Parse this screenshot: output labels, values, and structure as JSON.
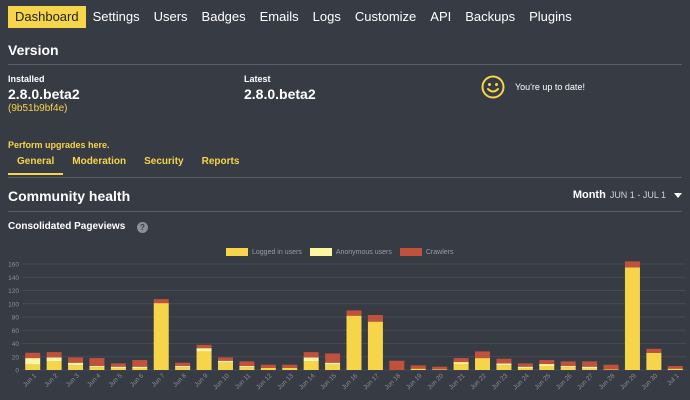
{
  "nav": {
    "items": [
      "Dashboard",
      "Settings",
      "Users",
      "Badges",
      "Emails",
      "Logs",
      "Customize",
      "API",
      "Backups",
      "Plugins"
    ],
    "active": "Dashboard"
  },
  "version": {
    "title": "Version",
    "installed_label": "Installed",
    "installed_value": "2.8.0.beta2",
    "installed_hash": "(9b51b9bf4e)",
    "latest_label": "Latest",
    "latest_value": "2.8.0.beta2",
    "status_text": "You're up to date!",
    "status_icon": "smiley-icon",
    "upgrade_link": "Perform upgrades here."
  },
  "tabs": [
    "General",
    "Moderation",
    "Security",
    "Reports"
  ],
  "active_tab": "General",
  "community": {
    "title": "Community health",
    "period_label": "Month",
    "period_range": "JUN 1 - JUL 1"
  },
  "pageviews": {
    "title": "Consolidated Pageviews",
    "help_icon": "question-icon"
  },
  "colors": {
    "accent": "#f7d54a",
    "background": "#373b44",
    "logged_in": "#f7d54a",
    "anonymous": "#fdf6a0",
    "crawlers": "#c0513c"
  },
  "chart_data": {
    "type": "bar",
    "stacked": true,
    "categories": [
      "Jun 1",
      "Jun 2",
      "Jun 3",
      "Jun 4",
      "Jun 5",
      "Jun 6",
      "Jun 7",
      "Jun 8",
      "Jun 9",
      "Jun 10",
      "Jun 11",
      "Jun 12",
      "Jun 13",
      "Jun 14",
      "Jun 15",
      "Jun 16",
      "Jun 17",
      "Jun 18",
      "Jun 19",
      "Jun 20",
      "Jun 21",
      "Jun 22",
      "Jun 23",
      "Jun 24",
      "Jun 25",
      "Jun 26",
      "Jun 27",
      "Jun 28",
      "Jun 29",
      "Jun 30",
      "Jul 1"
    ],
    "series": [
      {
        "name": "Logged in users",
        "values": [
          8,
          13,
          7,
          4,
          3,
          3,
          101,
          4,
          28,
          11,
          4,
          3,
          3,
          13,
          8,
          82,
          73,
          0,
          2,
          1,
          9,
          18,
          7,
          3,
          6,
          4,
          2,
          1,
          155,
          26,
          2
        ]
      },
      {
        "name": "Anonymous users",
        "values": [
          10,
          6,
          4,
          2,
          2,
          2,
          0,
          2,
          5,
          3,
          2,
          0,
          0,
          6,
          3,
          0,
          0,
          0,
          0,
          0,
          3,
          0,
          3,
          2,
          3,
          2,
          3,
          0,
          0,
          0,
          0
        ]
      },
      {
        "name": "Crawlers",
        "values": [
          8,
          8,
          8,
          12,
          5,
          10,
          6,
          5,
          5,
          5,
          7,
          5,
          5,
          8,
          14,
          8,
          10,
          14,
          5,
          4,
          6,
          10,
          7,
          5,
          6,
          7,
          8,
          7,
          9,
          6,
          4
        ]
      }
    ],
    "yticks": [
      "0",
      "20",
      "40",
      "60",
      "80",
      "100",
      "120",
      "140",
      "160"
    ],
    "ylim": [
      0,
      160
    ],
    "legend_position": "top-center"
  }
}
